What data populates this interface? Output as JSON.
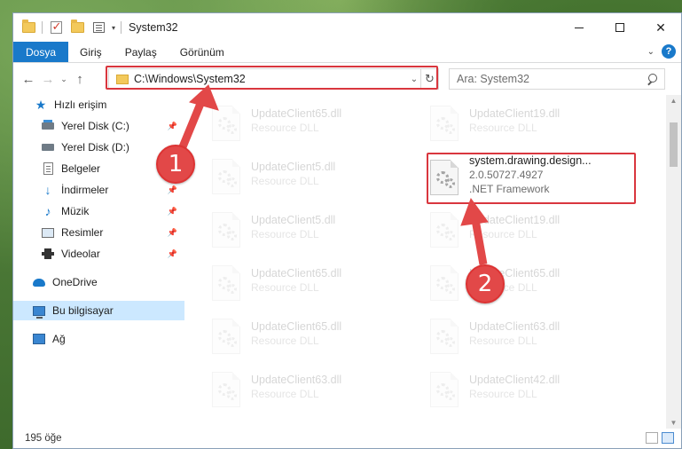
{
  "window": {
    "title": "System32"
  },
  "ribbon": {
    "tabs": [
      "Dosya",
      "Giriş",
      "Paylaş",
      "Görünüm"
    ],
    "help": "?"
  },
  "navigation": {
    "address_path": "C:\\Windows\\System32",
    "search_placeholder": "Ara: System32"
  },
  "sidebar": {
    "items": [
      {
        "label": "Hızlı erişim",
        "icon": "star-icon",
        "pinned": false
      },
      {
        "label": "Yerel Disk (C:)",
        "icon": "drive-icon",
        "pinned": true
      },
      {
        "label": "Yerel Disk (D:)",
        "icon": "drive-icon",
        "pinned": false
      },
      {
        "label": "Belgeler",
        "icon": "document-icon",
        "pinned": true
      },
      {
        "label": "İndirmeler",
        "icon": "download-icon",
        "pinned": true
      },
      {
        "label": "Müzik",
        "icon": "music-icon",
        "pinned": true
      },
      {
        "label": "Resimler",
        "icon": "pictures-icon",
        "pinned": true
      },
      {
        "label": "Videolar",
        "icon": "videos-icon",
        "pinned": true
      },
      {
        "label": "OneDrive",
        "icon": "cloud-icon",
        "pinned": false
      },
      {
        "label": "Bu bilgisayar",
        "icon": "computer-icon",
        "pinned": false,
        "selected": true
      },
      {
        "label": "Ağ",
        "icon": "network-icon",
        "pinned": false
      }
    ]
  },
  "files": {
    "left_column": [
      {
        "name": "UpdateClient65.dll",
        "type": "Resource DLL"
      },
      {
        "name": "UpdateClient5.dll",
        "type": "Resource DLL"
      },
      {
        "name": "UpdateClient5.dll",
        "type": "Resource DLL"
      },
      {
        "name": "UpdateClient65.dll",
        "type": "Resource DLL"
      },
      {
        "name": "UpdateClient65.dll",
        "type": "Resource DLL"
      },
      {
        "name": "UpdateClient63.dll",
        "type": "Resource DLL"
      }
    ],
    "right_column": [
      {
        "name": "UpdateClient19.dll",
        "type": "Resource DLL"
      },
      {
        "name": "system.drawing.design...",
        "version": "2.0.50727.4927",
        "type": ".NET Framework",
        "highlighted": true
      },
      {
        "name": "UpdateClient19.dll",
        "type": "Resource DLL"
      },
      {
        "name": "UpdateClient65.dll",
        "type": "Resource DLL"
      },
      {
        "name": "UpdateClient63.dll",
        "type": "Resource DLL"
      },
      {
        "name": "UpdateClient42.dll",
        "type": "Resource DLL"
      }
    ]
  },
  "annotations": {
    "badge1": "1",
    "badge2": "2",
    "color": "#e24848"
  },
  "status": {
    "item_count": "195 öğe"
  },
  "colors": {
    "accent": "#1979ca",
    "selection": "#cce8ff",
    "highlight_border": "#d9363e"
  }
}
